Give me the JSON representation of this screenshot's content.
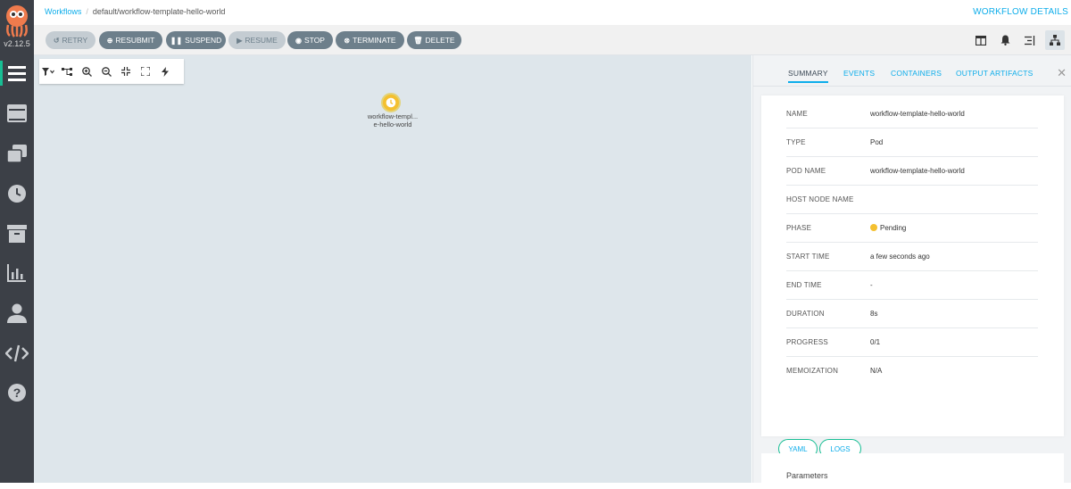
{
  "app": {
    "version": "v2.12.5"
  },
  "breadcrumb": {
    "root": "Workflows",
    "current": "default/workflow-template-hello-world"
  },
  "page_title": "WORKFLOW DETAILS",
  "sidebar": {
    "items": [
      {
        "icon": "workflows-icon",
        "active": true
      },
      {
        "icon": "workflow-templates-icon"
      },
      {
        "icon": "cluster-workflow-templates-icon"
      },
      {
        "icon": "cron-workflows-icon"
      },
      {
        "icon": "archived-workflows-icon"
      },
      {
        "icon": "reports-icon"
      },
      {
        "icon": "user-icon"
      },
      {
        "icon": "api-docs-icon"
      },
      {
        "icon": "help-icon"
      }
    ]
  },
  "toolbar": {
    "buttons": [
      {
        "label": "RETRY",
        "icon": "retry-icon",
        "disabled": true
      },
      {
        "label": "RESUBMIT",
        "icon": "plus-circle-icon"
      },
      {
        "label": "SUSPEND",
        "icon": "pause-icon"
      },
      {
        "label": "RESUME",
        "icon": "play-icon",
        "disabled": true
      },
      {
        "label": "STOP",
        "icon": "stop-circle-icon"
      },
      {
        "label": "TERMINATE",
        "icon": "times-circle-icon"
      },
      {
        "label": "DELETE",
        "icon": "trash-icon"
      }
    ]
  },
  "graph": {
    "node": {
      "label": "workflow-templ...\ne-hello-world",
      "phase": "Pending",
      "color": "#f4c030"
    }
  },
  "panel": {
    "tabs": [
      "SUMMARY",
      "EVENTS",
      "CONTAINERS",
      "OUTPUT ARTIFACTS"
    ],
    "active_tab": "SUMMARY",
    "summary": [
      {
        "key": "NAME",
        "value": "workflow-template-hello-world"
      },
      {
        "key": "TYPE",
        "value": "Pod"
      },
      {
        "key": "POD NAME",
        "value": "workflow-template-hello-world"
      },
      {
        "key": "HOST NODE NAME",
        "value": ""
      },
      {
        "key": "PHASE",
        "value": "Pending"
      },
      {
        "key": "START TIME",
        "value": "a few seconds ago"
      },
      {
        "key": "END TIME",
        "value": "-"
      },
      {
        "key": "DURATION",
        "value": "8s"
      },
      {
        "key": "PROGRESS",
        "value": "0/1"
      },
      {
        "key": "MEMOIZATION",
        "value": "N/A"
      }
    ],
    "yaml_label": "YAML",
    "logs_label": "LOGS",
    "parameters_title": "Parameters"
  },
  "colors": {
    "accent": "#0dadea",
    "sidebar": "#3c4047",
    "pending": "#f4c030",
    "button": "#6d7f8b"
  }
}
